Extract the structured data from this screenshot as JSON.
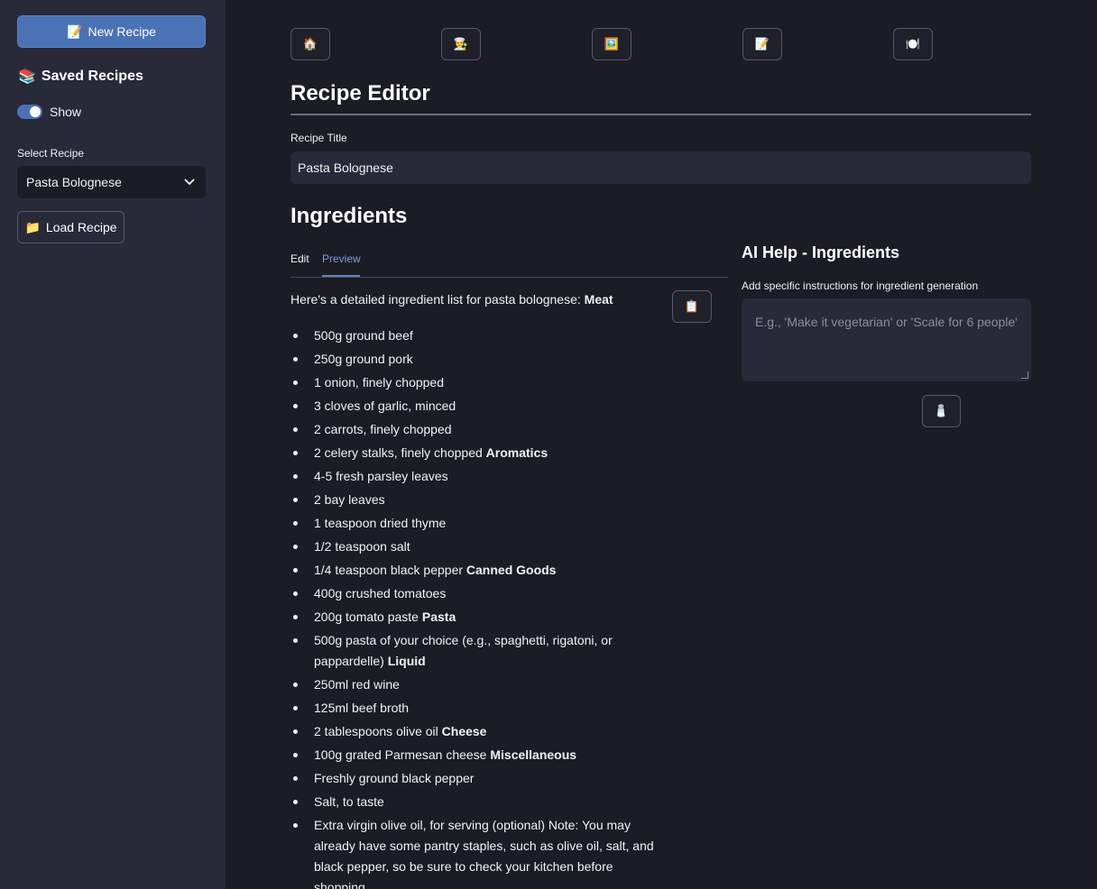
{
  "sidebar": {
    "new_recipe_label": "New Recipe",
    "new_recipe_icon": "📝",
    "saved_heading": "Saved Recipes",
    "saved_icon": "📚",
    "toggle_label": "Show",
    "toggle_on": true,
    "select_label": "Select Recipe",
    "select_value": "Pasta Bolognese",
    "load_label": "Load Recipe",
    "load_icon": "📁"
  },
  "toolbar": {
    "icons": [
      {
        "name": "home-icon",
        "glyph": "🏠"
      },
      {
        "name": "chef-icon",
        "glyph": "👨‍🍳"
      },
      {
        "name": "image-icon",
        "glyph": "🖼️"
      },
      {
        "name": "recipe-icon",
        "glyph": "📝"
      },
      {
        "name": "plate-icon",
        "glyph": "🍽️"
      }
    ]
  },
  "editor": {
    "title": "Recipe Editor",
    "recipe_title_label": "Recipe Title",
    "recipe_title_value": "Pasta Bolognese"
  },
  "ingredients": {
    "heading": "Ingredients",
    "tabs": [
      "Edit",
      "Preview"
    ],
    "active_tab": "Preview",
    "intro": "Here's a detailed ingredient list for pasta bolognese: ",
    "intro_bold": "Meat",
    "copy_icon": "📋",
    "items": [
      {
        "text": "500g ground beef",
        "bold": ""
      },
      {
        "text": "250g ground pork",
        "bold": ""
      },
      {
        "text": "1 onion, finely chopped",
        "bold": ""
      },
      {
        "text": "3 cloves of garlic, minced",
        "bold": ""
      },
      {
        "text": "2 carrots, finely chopped",
        "bold": ""
      },
      {
        "text": "2 celery stalks, finely chopped ",
        "bold": "Aromatics"
      },
      {
        "text": "4-5 fresh parsley leaves",
        "bold": ""
      },
      {
        "text": "2 bay leaves",
        "bold": ""
      },
      {
        "text": "1 teaspoon dried thyme",
        "bold": ""
      },
      {
        "text": "1/2 teaspoon salt",
        "bold": ""
      },
      {
        "text": "1/4 teaspoon black pepper ",
        "bold": "Canned Goods"
      },
      {
        "text": "400g crushed tomatoes",
        "bold": ""
      },
      {
        "text": "200g tomato paste ",
        "bold": "Pasta"
      },
      {
        "text": "500g pasta of your choice (e.g., spaghetti, rigatoni, or pappardelle) ",
        "bold": "Liquid"
      },
      {
        "text": "250ml red wine",
        "bold": ""
      },
      {
        "text": "125ml beef broth",
        "bold": ""
      },
      {
        "text": "2 tablespoons olive oil ",
        "bold": "Cheese"
      },
      {
        "text": "100g grated Parmesan cheese ",
        "bold": "Miscellaneous"
      },
      {
        "text": "Freshly ground black pepper",
        "bold": ""
      },
      {
        "text": "Salt, to taste",
        "bold": ""
      },
      {
        "text": "Extra virgin olive oil, for serving (optional) Note: You may already have some pantry staples, such as olive oil, salt, and black pepper, so be sure to check your kitchen before shopping.",
        "bold": ""
      }
    ]
  },
  "ai_help": {
    "title": "AI Help - Ingredients",
    "instructions_label": "Add specific instructions for ingredient generation",
    "placeholder": "E.g., 'Make it vegetarian' or 'Scale for 6 people'",
    "generate_icon": "🧂"
  }
}
